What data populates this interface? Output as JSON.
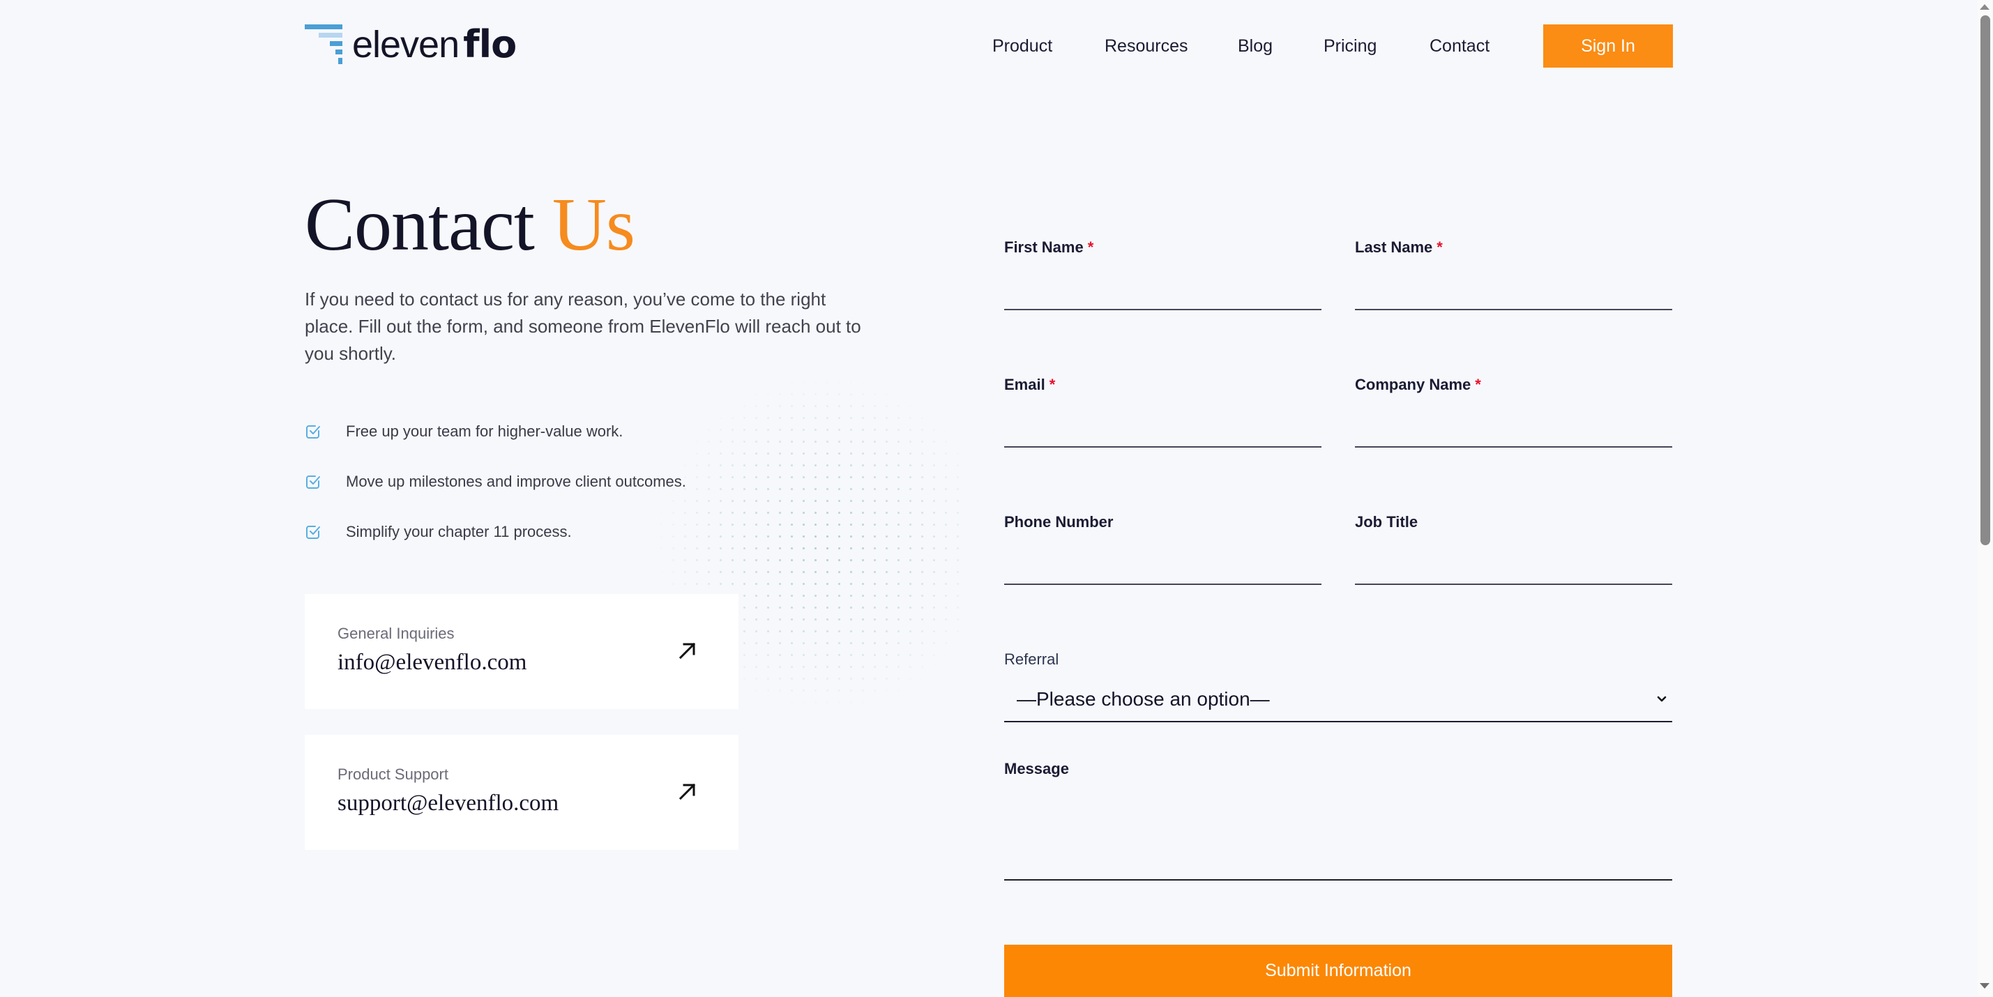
{
  "brand": {
    "name_light": "eleven",
    "name_bold": "flo",
    "logo_bar_colors": [
      "#4a9fd5",
      "#b7d6ee",
      "#4a9fd5",
      "#4a9fd5",
      "#4a9fd5"
    ]
  },
  "nav": {
    "items": [
      {
        "label": "Product"
      },
      {
        "label": "Resources"
      },
      {
        "label": "Blog"
      },
      {
        "label": "Pricing"
      },
      {
        "label": "Contact"
      }
    ],
    "signin_label": "Sign In"
  },
  "hero": {
    "title_main": "Contact",
    "title_accent": "Us",
    "intro": "If you need to contact us for any reason, you’ve come to the right place. Fill out the form, and someone from ElevenFlo will reach out to you shortly."
  },
  "benefits": [
    {
      "icon": "checkbox-checked-icon",
      "text": "Free up your team for higher-value work."
    },
    {
      "icon": "checkbox-checked-icon",
      "text": "Move up milestones and improve client outcomes."
    },
    {
      "icon": "checkbox-checked-icon",
      "text": "Simplify your chapter 11 process."
    }
  ],
  "contact_cards": [
    {
      "label": "General Inquiries",
      "email": "info@elevenflo.com",
      "icon": "arrow-up-right-icon"
    },
    {
      "label": "Product Support",
      "email": "support@elevenflo.com",
      "icon": "arrow-up-right-icon"
    }
  ],
  "form": {
    "fields": {
      "first_name": {
        "label": "First Name",
        "required_mark": "*",
        "value": ""
      },
      "last_name": {
        "label": "Last Name",
        "required_mark": "*",
        "value": ""
      },
      "email": {
        "label": "Email",
        "required_mark": "*",
        "value": ""
      },
      "company_name": {
        "label": "Company Name",
        "required_mark": "*",
        "value": ""
      },
      "phone": {
        "label": "Phone Number",
        "value": ""
      },
      "job_title": {
        "label": "Job Title",
        "value": ""
      }
    },
    "referral": {
      "label": "Referral",
      "selected": "—Please choose an option—"
    },
    "message": {
      "label": "Message",
      "value": ""
    },
    "submit_label": "Submit Information"
  },
  "colors": {
    "accent": "#fb8c14",
    "required": "#e8112d",
    "background": "#f7f8fc",
    "check_icon": "#5aaee0"
  }
}
